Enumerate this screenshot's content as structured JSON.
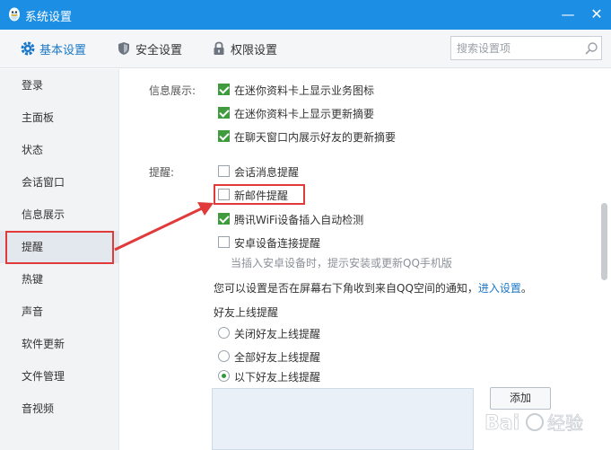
{
  "window": {
    "title": "系统设置",
    "min_symbol": "—",
    "close_symbol": "✕"
  },
  "tabs": [
    {
      "label": "基本设置",
      "icon": "gear-icon",
      "active": true
    },
    {
      "label": "安全设置",
      "icon": "shield-icon",
      "active": false
    },
    {
      "label": "权限设置",
      "icon": "lock-icon",
      "active": false
    }
  ],
  "search": {
    "placeholder": "搜索设置项"
  },
  "sidebar": {
    "items": [
      {
        "label": "登录"
      },
      {
        "label": "主面板"
      },
      {
        "label": "状态"
      },
      {
        "label": "会话窗口"
      },
      {
        "label": "信息展示"
      },
      {
        "label": "提醒",
        "active": true
      },
      {
        "label": "热键"
      },
      {
        "label": "声音"
      },
      {
        "label": "软件更新"
      },
      {
        "label": "文件管理"
      },
      {
        "label": "音视频"
      }
    ]
  },
  "info_display": {
    "label": "信息展示:",
    "options": [
      {
        "label": "在迷你资料卡上显示业务图标",
        "checked": true
      },
      {
        "label": "在迷你资料卡上显示更新摘要",
        "checked": true
      },
      {
        "label": "在聊天窗口内展示好友的更新摘要",
        "checked": true
      }
    ]
  },
  "reminder": {
    "label": "提醒:",
    "options": [
      {
        "label": "会话消息提醒",
        "checked": false
      },
      {
        "label": "新邮件提醒",
        "checked": false
      },
      {
        "label": "腾讯WiFi设备插入自动检测",
        "checked": true
      },
      {
        "label": "安卓设备连接提醒",
        "checked": false
      }
    ],
    "android_hint": "当插入安卓设备时，提示安装或更新QQ手机版",
    "qzone_notice": "您可以设置是否在屏幕右下角收到来自QQ空间的通知，",
    "qzone_link": "进入设置",
    "qzone_period": "。"
  },
  "friend_online": {
    "title": "好友上线提醒",
    "options": [
      {
        "label": "关闭好友上线提醒",
        "selected": false
      },
      {
        "label": "全部好友上线提醒",
        "selected": false
      },
      {
        "label": "以下好友上线提醒",
        "selected": true
      }
    ],
    "add_button": "添加"
  },
  "colors": {
    "titlebar": "#1c8ee3",
    "accent": "#1b78c8",
    "check_green": "#3f9b3d",
    "highlight_red": "#e03a3a"
  },
  "watermark": {
    "text": "Baidu 经验"
  }
}
